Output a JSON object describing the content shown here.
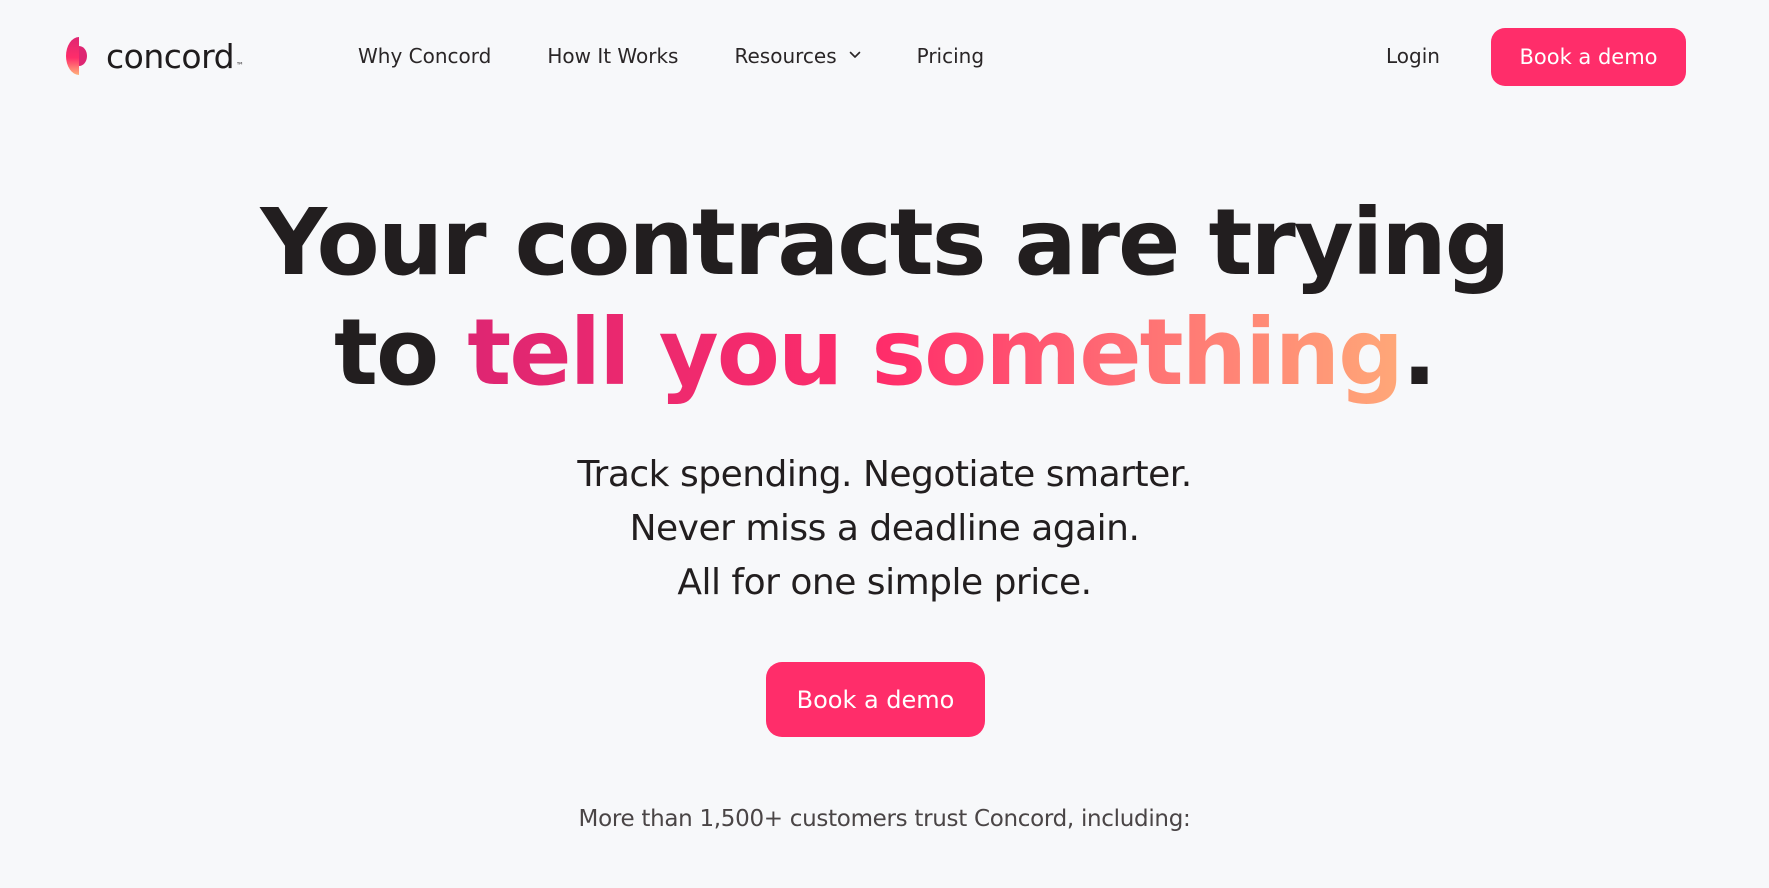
{
  "brand": {
    "name": "concord",
    "trademark": "™",
    "accent_color": "#ff2d6a",
    "gradient": [
      "#de2672",
      "#ff2d6a",
      "#ffa878"
    ],
    "logo_icon": "concord-logo-icon"
  },
  "nav": {
    "items": [
      {
        "label": "Why Concord"
      },
      {
        "label": "How It Works"
      },
      {
        "label": "Resources",
        "has_dropdown": true,
        "icon": "chevron-down-icon"
      },
      {
        "label": "Pricing"
      }
    ],
    "login_label": "Login",
    "demo_label": "Book a demo"
  },
  "hero": {
    "title_line1": "Your contracts are trying",
    "title_line2_prefix": "to ",
    "title_line2_accent": "tell you something",
    "title_line2_suffix": ".",
    "subtitle_lines": [
      "Track spending. Negotiate smarter.",
      "Never miss a deadline again.",
      "All for one simple price."
    ],
    "cta_label": "Book a demo",
    "trust_text": "More than 1,500+ customers trust Concord, including:"
  }
}
